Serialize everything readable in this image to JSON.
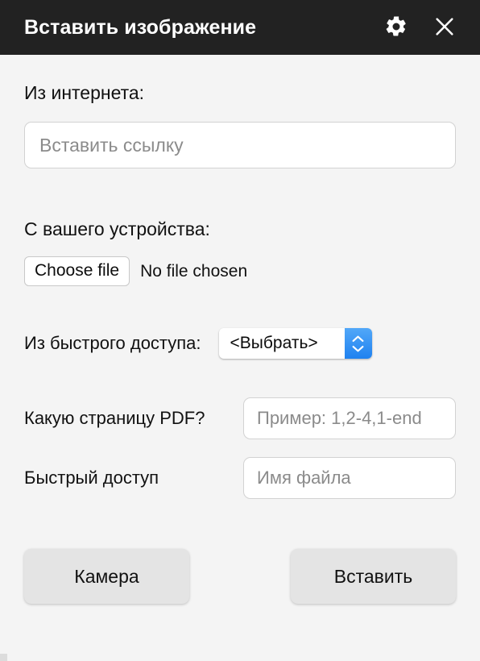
{
  "window": {
    "title": "Вставить изображение",
    "titlebar_bg": "#222222",
    "page_bg": "#f4f4f4",
    "settings_icon": "gear-icon",
    "close_icon": "close-icon"
  },
  "url_section": {
    "label": "Из интернета:",
    "input_placeholder": "Вставить ссылку",
    "input_value": ""
  },
  "device_section": {
    "label": "С вашего устройства:",
    "choose_file_label": "Choose file",
    "file_status": "No file chosen"
  },
  "quick_select": {
    "label": "Из быстрого доступа:",
    "selected": "<Выбрать>",
    "options": [
      "<Выбрать>"
    ],
    "accent_color": "#1f82f0"
  },
  "pdf_page": {
    "label": "Какую страницу PDF?",
    "placeholder": "Пример: 1,2-4,1-end",
    "value": ""
  },
  "quick_access": {
    "label": "Быстрый доступ",
    "placeholder": "Имя файла",
    "value": ""
  },
  "footer": {
    "camera_label": "Камера",
    "insert_label": "Вставить"
  }
}
